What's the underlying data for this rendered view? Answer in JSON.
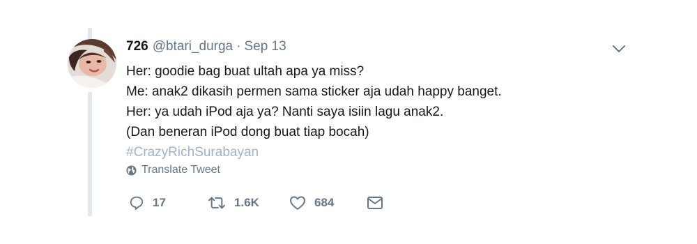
{
  "tweet": {
    "author_name": "726",
    "handle": "@btari_durga",
    "separator": "·",
    "date": "Sep 13",
    "lines": [
      "Her: goodie bag buat ultah apa ya miss?",
      "Me: anak2 dikasih permen sama sticker aja udah happy banget.",
      "Her: ya udah iPod aja ya? Nanti saya isiin lagu anak2.",
      "(Dan beneran iPod dong buat tiap bocah)"
    ],
    "hashtag": "#CrazyRichSurabayan",
    "translate_label": "Translate Tweet"
  },
  "actions": {
    "reply_count": "17",
    "retweet_count": "1.6K",
    "like_count": "684"
  },
  "icons": {
    "caret": "chevron-down-icon",
    "translate": "globe-icon",
    "reply": "reply-icon",
    "retweet": "retweet-icon",
    "like": "heart-icon",
    "dm": "envelope-icon"
  },
  "colors": {
    "text_primary": "#14171a",
    "text_secondary": "#657786",
    "hashtag": "#9fb3c8",
    "thread_line": "#e1e8ed"
  }
}
